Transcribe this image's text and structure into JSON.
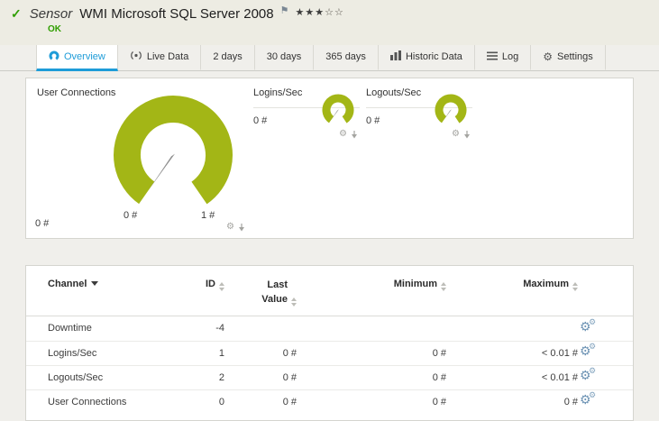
{
  "colors": {
    "accent_blue": "#1e9cd8",
    "gauge_green": "#a3b616",
    "status_green": "#2f9e00"
  },
  "icons": {
    "check": "✓",
    "flag": "⚑",
    "gear": "⚙",
    "stars_filled": "★★★",
    "stars_empty": "☆☆"
  },
  "header": {
    "kind": "Sensor",
    "title": "WMI Microsoft SQL Server 2008",
    "status": "OK",
    "rating_filled_count": 3,
    "rating_total": 5
  },
  "tabs": [
    {
      "label": "Overview",
      "active": true
    },
    {
      "label": "Live Data"
    },
    {
      "label": "2 days"
    },
    {
      "label": "30 days"
    },
    {
      "label": "365 days"
    },
    {
      "label": "Historic Data"
    },
    {
      "label": "Log"
    },
    {
      "label": "Settings"
    }
  ],
  "gauge_panel": {
    "primary": {
      "title": "User Connections",
      "current": "0 #",
      "scale_min": "0 #",
      "scale_max": "1 #",
      "value": 0,
      "min": 0,
      "max": 1
    },
    "small": [
      {
        "title": "Logins/Sec",
        "current": "0 #",
        "value": 0
      },
      {
        "title": "Logouts/Sec",
        "current": "0 #",
        "value": 0
      }
    ]
  },
  "table": {
    "headers": {
      "channel": "Channel",
      "id": "ID",
      "last_value": "Last Value",
      "minimum": "Minimum",
      "maximum": "Maximum"
    },
    "rows": [
      {
        "channel": "Downtime",
        "id": "-4",
        "last": "",
        "min": "",
        "max": ""
      },
      {
        "channel": "Logins/Sec",
        "id": "1",
        "last": "0 #",
        "min": "0 #",
        "max": "< 0.01 #"
      },
      {
        "channel": "Logouts/Sec",
        "id": "2",
        "last": "0 #",
        "min": "0 #",
        "max": "< 0.01 #"
      },
      {
        "channel": "User Connections",
        "id": "0",
        "last": "0 #",
        "min": "0 #",
        "max": "0 #"
      }
    ]
  }
}
